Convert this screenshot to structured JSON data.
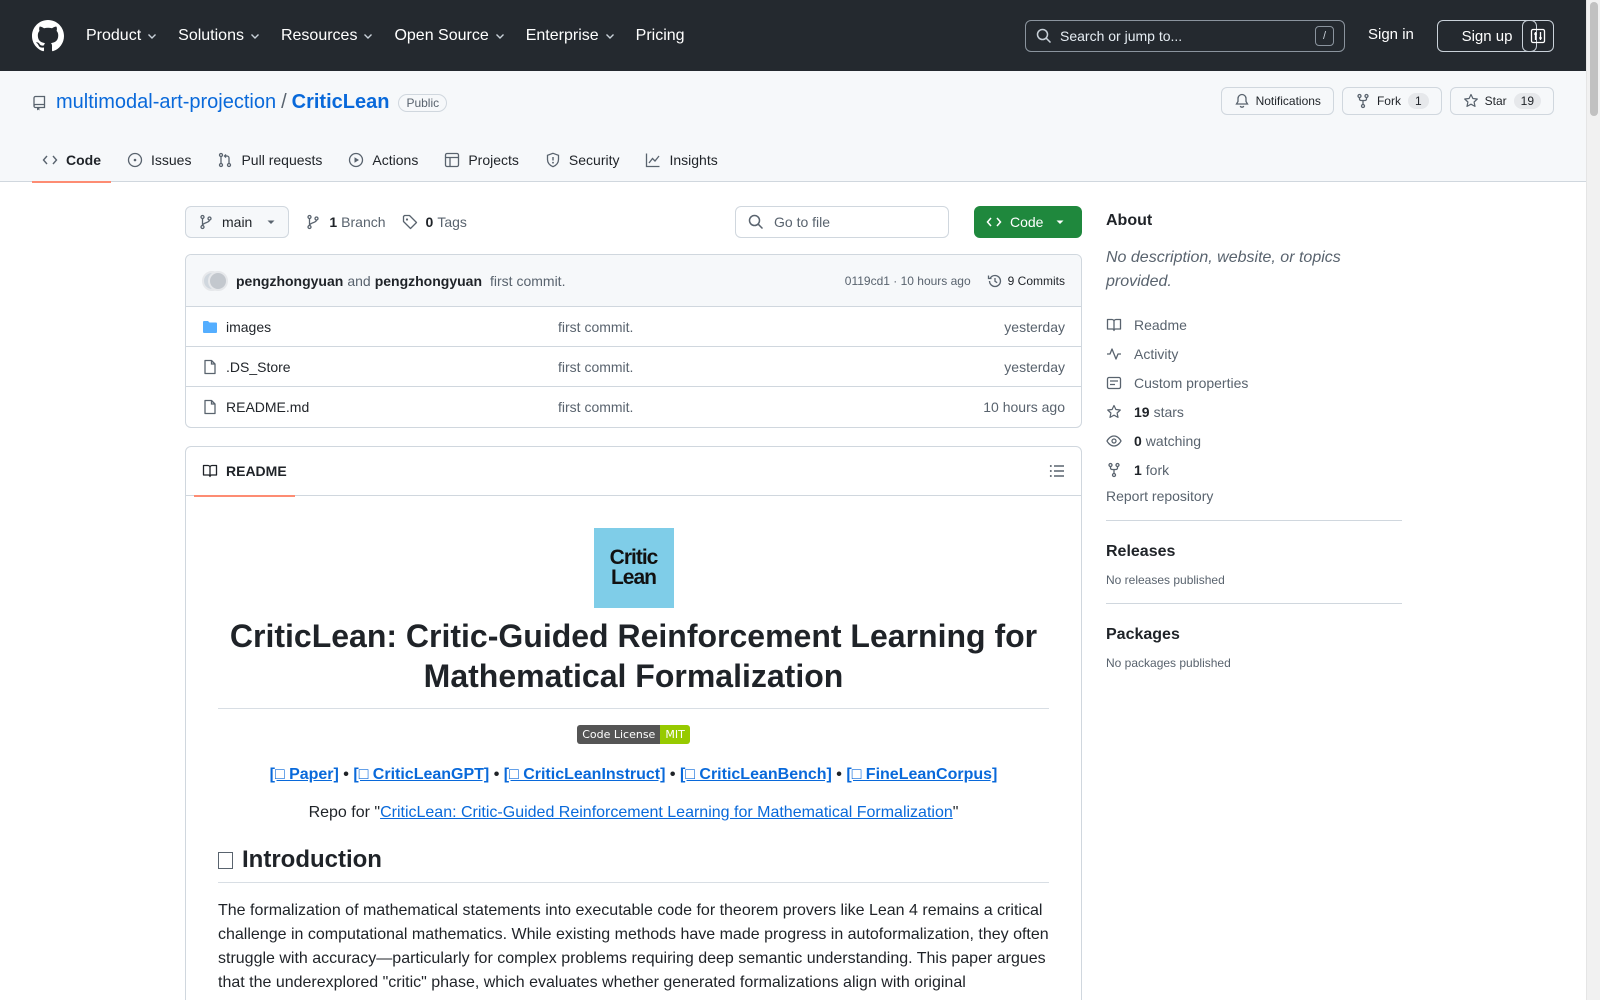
{
  "header": {
    "nav": [
      "Product",
      "Solutions",
      "Resources",
      "Open Source",
      "Enterprise",
      "Pricing"
    ],
    "search_placeholder": "Search or jump to...",
    "search_key": "/",
    "sign_in": "Sign in",
    "sign_up": "Sign up"
  },
  "repo": {
    "owner": "multimodal-art-projection",
    "separator": "/",
    "name": "CriticLean",
    "visibility": "Public",
    "notifications_label": "Notifications",
    "fork_label": "Fork",
    "fork_count": "1",
    "star_label": "Star",
    "star_count": "19",
    "tabs": [
      "Code",
      "Issues",
      "Pull requests",
      "Actions",
      "Projects",
      "Security",
      "Insights"
    ]
  },
  "toolbar": {
    "branch": "main",
    "branches_count": "1",
    "branches_label": "Branch",
    "tags_count": "0",
    "tags_label": "Tags",
    "goto_placeholder": "Go to file",
    "code_label": "Code"
  },
  "commit": {
    "author1": "pengzhongyuan",
    "and": "and",
    "author2": "pengzhongyuan",
    "message": "first commit.",
    "sha_time": "0119cd1 · 10 hours ago",
    "commits_label": "9 Commits"
  },
  "files": [
    {
      "name": "images",
      "message": "first commit.",
      "date": "yesterday",
      "type": "folder"
    },
    {
      "name": ".DS_Store",
      "message": "first commit.",
      "date": "yesterday",
      "type": "file"
    },
    {
      "name": "README.md",
      "message": "first commit.",
      "date": "10 hours ago",
      "type": "file"
    }
  ],
  "readme": {
    "tab_label": "README",
    "logo_line1": "Critic",
    "logo_line2": "Lean",
    "title": "CriticLean: Critic-Guided Reinforcement Learning for Mathematical Formalization",
    "badge_left": "Code License",
    "badge_right": "MIT",
    "links": [
      "[□ Paper]",
      "[□ CriticLeanGPT]",
      "[□ CriticLeanInstruct]",
      "[□ CriticLeanBench]",
      "[□ FineLeanCorpus]"
    ],
    "link_sep": " • ",
    "repo_for_prefix": "Repo for \"",
    "repo_for_link": "CriticLean: Critic-Guided Reinforcement Learning for Mathematical Formalization",
    "repo_for_suffix": "\"",
    "intro_heading": "Introduction",
    "intro_text": "The formalization of mathematical statements into executable code for theorem provers like Lean 4 remains a critical challenge in computational mathematics. While existing methods have made progress in autoformalization, they often struggle with accuracy—particularly for complex problems requiring deep semantic understanding. This paper argues that the underexplored \"critic\" phase, which evaluates whether generated formalizations align with original"
  },
  "sidebar": {
    "about_heading": "About",
    "about_desc": "No description, website, or topics provided.",
    "items": [
      {
        "icon": "book-icon",
        "label": "Readme",
        "count": ""
      },
      {
        "icon": "pulse-icon",
        "label": "Activity",
        "count": ""
      },
      {
        "icon": "note-icon",
        "label": "Custom properties",
        "count": ""
      },
      {
        "icon": "star-icon",
        "label": "stars",
        "count": "19"
      },
      {
        "icon": "eye-icon",
        "label": "watching",
        "count": "0"
      },
      {
        "icon": "fork-icon",
        "label": "fork",
        "count": "1"
      }
    ],
    "report": "Report repository",
    "releases_heading": "Releases",
    "releases_text": "No releases published",
    "packages_heading": "Packages",
    "packages_text": "No packages published"
  }
}
